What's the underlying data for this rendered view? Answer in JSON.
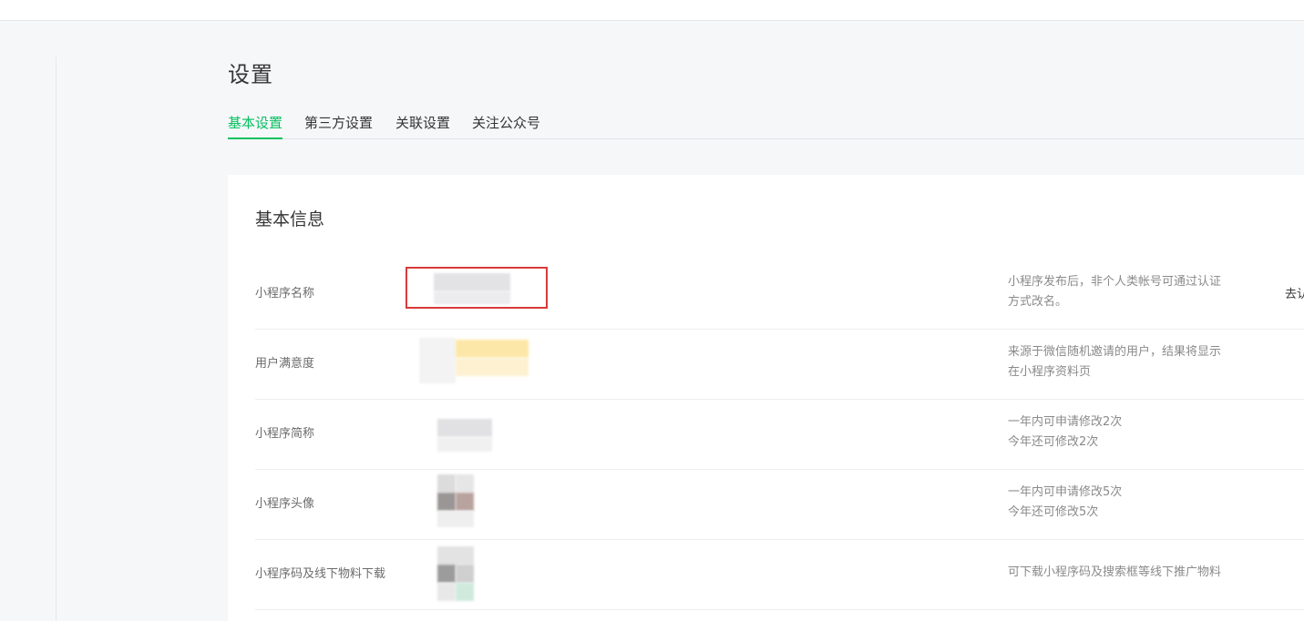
{
  "page": {
    "title": "设置"
  },
  "tabs": [
    {
      "label": "基本设置",
      "active": true
    },
    {
      "label": "第三方设置",
      "active": false
    },
    {
      "label": "关联设置",
      "active": false
    },
    {
      "label": "关注公众号",
      "active": false
    }
  ],
  "card": {
    "title": "基本信息",
    "rows": [
      {
        "label": "小程序名称",
        "desc_lines": [
          "小程序发布后，非个人类帐号可通过认证",
          "方式改名。"
        ],
        "action": "去认"
      },
      {
        "label": "用户满意度",
        "desc_lines": [
          "来源于微信随机邀请的用户，结果将显示",
          "在小程序资料页"
        ]
      },
      {
        "label": "小程序简称",
        "desc_lines": [
          "一年内可申请修改2次",
          "今年还可修改2次"
        ]
      },
      {
        "label": "小程序头像",
        "desc_lines": [
          "一年内可申请修改5次",
          "今年还可修改5次"
        ]
      },
      {
        "label": "小程序码及线下物料下载",
        "desc_lines": [
          "可下载小程序码及搜索框等线下推广物料"
        ]
      }
    ]
  },
  "colors": {
    "accent": "#07c160",
    "highlight": "#d93a3a",
    "background": "#f6f7f9"
  }
}
